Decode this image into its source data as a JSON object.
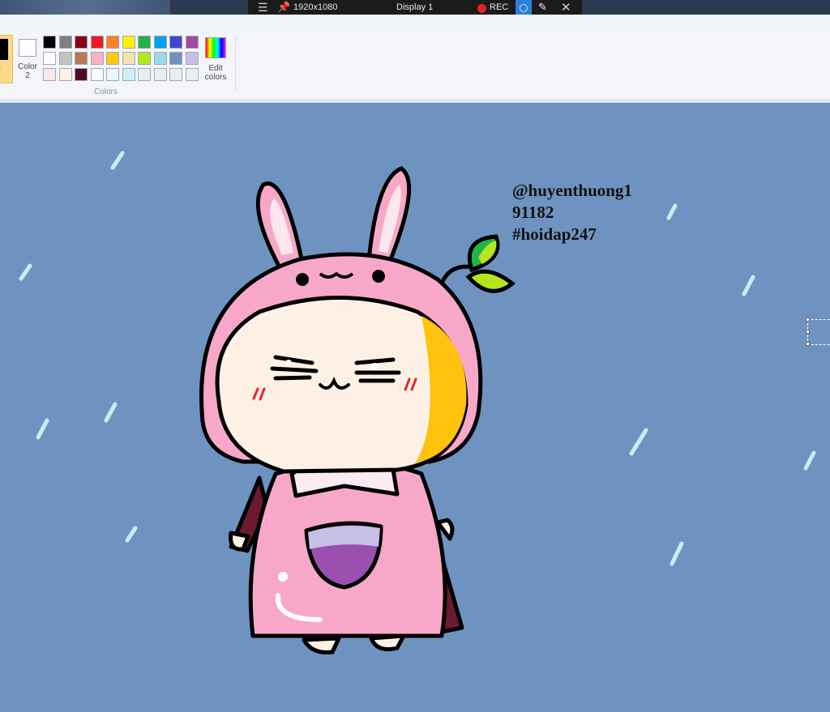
{
  "recorder": {
    "resolution": "1920x1080",
    "display": "Display 1",
    "rec_label": "REC"
  },
  "ribbon": {
    "color1_label": "or",
    "color2_label_line1": "Color",
    "color2_label_line2": "2",
    "edit_colors_line1": "Edit",
    "edit_colors_line2": "colors",
    "group_label": "Colors",
    "color1": "#000000",
    "color2": "#ffffff",
    "palette_rows": [
      [
        "#000000",
        "#7f7f7f",
        "#880015",
        "#ed1c24",
        "#ff7f27",
        "#fff200",
        "#22b14c",
        "#00a2e8",
        "#3f48cc",
        "#a349a4"
      ],
      [
        "#ffffff",
        "#c3c3c3",
        "#b97a57",
        "#ffaec9",
        "#ffc90e",
        "#efe4b0",
        "#b5e61d",
        "#99d9ea",
        "#7092be",
        "#c8bfe7"
      ],
      [
        "#fde6ee",
        "#fdf1e6",
        "#4a0f1f",
        "#f4fafe",
        "#eaf8fb",
        "#cdeff5",
        "#e9eef4",
        "#e9eef4",
        "#e9eef4",
        "#e9eef4"
      ]
    ]
  },
  "canvas": {
    "background": "#6f93c0",
    "watermark": [
      "@huyenthuong1",
      "91182",
      "#hoidap247"
    ]
  }
}
